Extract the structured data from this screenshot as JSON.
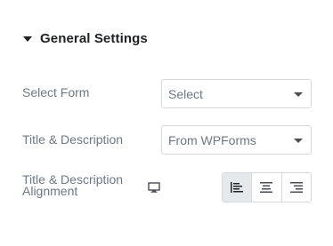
{
  "section": {
    "title": "General Settings"
  },
  "fields": {
    "select_form": {
      "label": "Select Form",
      "value": "Select"
    },
    "title_description": {
      "label": "Title & Description",
      "value": "From WPForms"
    },
    "alignment": {
      "label_line1": "Title & Description",
      "label_line2": "Alignment",
      "device_icon": "desktop-monitor-icon",
      "options": [
        "align-left-icon",
        "align-center-icon",
        "align-right-icon"
      ],
      "selected": "left"
    }
  },
  "colors": {
    "text": "#6d7882",
    "heading": "#1f2124",
    "border": "#d5d8dc",
    "active_bg": "#e6e9ec"
  }
}
